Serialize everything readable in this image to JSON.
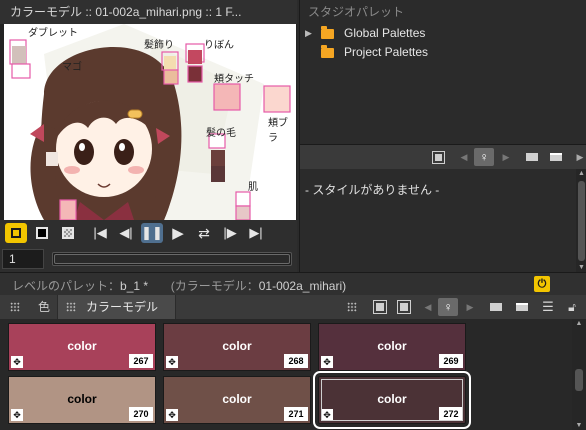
{
  "viewer": {
    "title": "カラーモデル :: 01-002a_mihari.png  ::  1 F...",
    "frame_value": "1",
    "art_labels": {
      "a": "ダブレット",
      "b": "マゴ",
      "c": "髪飾り",
      "d": "りぼん",
      "e": "頬タッチ",
      "f": "髪の毛",
      "g": "頬ブラ",
      "h": "肌"
    },
    "controls": [
      {
        "icon": "camera-stand-toggle-icon",
        "glyph": "■"
      },
      {
        "icon": "black-bg-icon",
        "glyph": "■"
      },
      {
        "icon": "checker-bg-icon",
        "glyph": "▣"
      },
      {
        "icon": "first-frame-icon",
        "glyph": "⏮"
      },
      {
        "icon": "prev-frame-icon",
        "glyph": "◀"
      },
      {
        "icon": "pause-icon",
        "glyph": "⏸"
      },
      {
        "icon": "play-icon",
        "glyph": "▶"
      },
      {
        "icon": "loop-icon",
        "glyph": "⟲"
      },
      {
        "icon": "next-frame-icon",
        "glyph": "▶"
      },
      {
        "icon": "last-frame-icon",
        "glyph": "⏭"
      }
    ]
  },
  "studio_palette": {
    "title": "スタジオパレット",
    "items": [
      {
        "label": "Global Palettes",
        "icon": "folder-icon"
      },
      {
        "label": "Project Palettes",
        "icon": "folder-icon"
      }
    ]
  },
  "style_panel": {
    "empty_text": "- スタイルがありません -"
  },
  "level_palette": {
    "title_prefix": "レベルのパレット：",
    "palette_name": "b_1 *",
    "model_prefix": "(カラーモデル：",
    "model_name": "01-002a_mihari)",
    "tabs": [
      {
        "label": "色"
      },
      {
        "label": "カラーモデル"
      }
    ],
    "swatches": [
      {
        "name": "color",
        "id": "267",
        "color": "#a8415a",
        "text_color": "#ffffff"
      },
      {
        "name": "color",
        "id": "268",
        "color": "#6b3d42",
        "text_color": "#ffffff"
      },
      {
        "name": "color",
        "id": "269",
        "color": "#55303d",
        "text_color": "#ffffff"
      },
      {
        "name": "color",
        "id": "270",
        "color": "#b19484",
        "text_color": "#000000"
      },
      {
        "name": "color",
        "id": "271",
        "color": "#6f5048",
        "text_color": "#ffffff"
      },
      {
        "name": "color",
        "id": "272",
        "color": "#4b3236",
        "text_color": "#ffffff",
        "selected": true
      }
    ]
  },
  "colors": {
    "accent_yellow": "#f2c500",
    "folder_orange": "#f5a623",
    "pause_highlight": "#4f6f8f"
  }
}
